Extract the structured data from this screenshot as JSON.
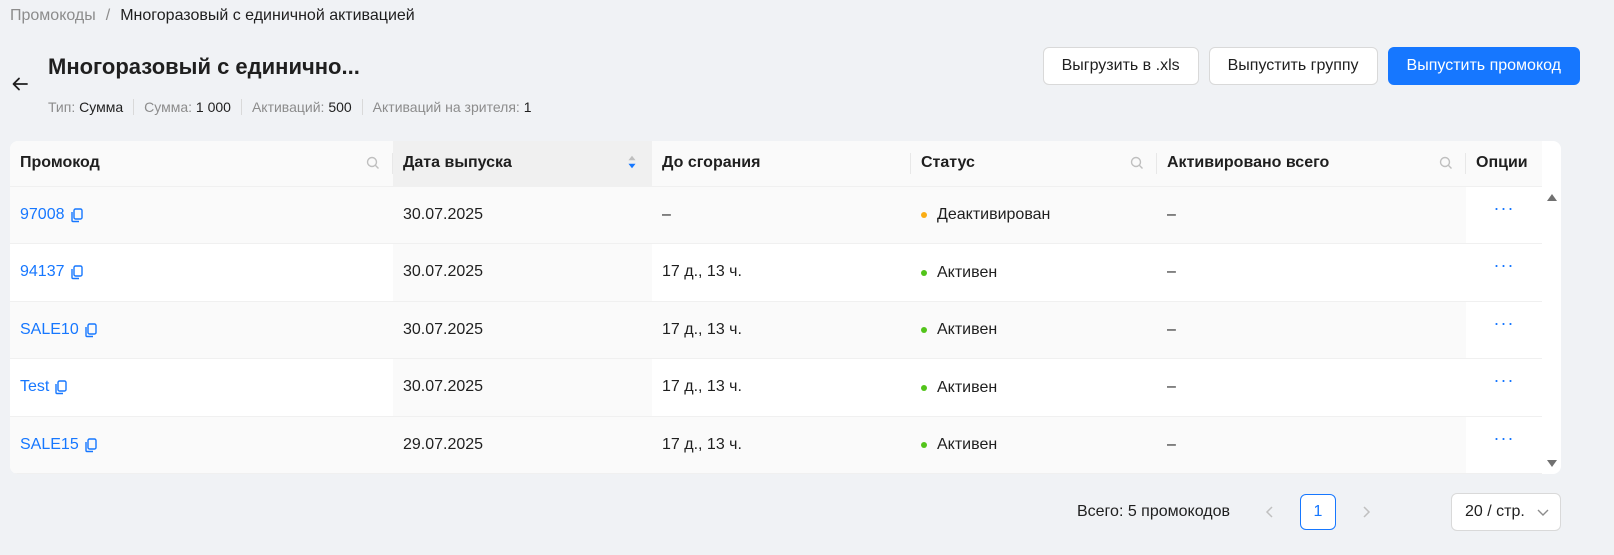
{
  "breadcrumb": {
    "parent": "Промокоды",
    "separator": "/",
    "current": "Многоразовый с единичной активацией"
  },
  "header": {
    "title": "Многоразовый с единично...",
    "meta": [
      {
        "label": "Тип:",
        "value": "Сумма"
      },
      {
        "label": "Сумма:",
        "value": "1 000"
      },
      {
        "label": "Активаций:",
        "value": "500"
      },
      {
        "label": "Активаций на зрителя:",
        "value": "1"
      }
    ]
  },
  "actions": {
    "export": "Выгрузить в .xls",
    "issue_group": "Выпустить группу",
    "issue_promo": "Выпустить промокод"
  },
  "table": {
    "columns": [
      "Промокод",
      "Дата выпуска",
      "До сгорания",
      "Статус",
      "Активировано всего",
      "Опции"
    ],
    "rows": [
      {
        "code": "97008",
        "date": "30.07.2025",
        "expires": "–",
        "status": "Деактивирован",
        "status_color": "#faad14",
        "activated": "–"
      },
      {
        "code": "94137",
        "date": "30.07.2025",
        "expires": "17 д., 13 ч.",
        "status": "Активен",
        "status_color": "#52c41a",
        "activated": "–"
      },
      {
        "code": "SALE10",
        "date": "30.07.2025",
        "expires": "17 д., 13 ч.",
        "status": "Активен",
        "status_color": "#52c41a",
        "activated": "–"
      },
      {
        "code": "Test",
        "date": "30.07.2025",
        "expires": "17 д., 13 ч.",
        "status": "Активен",
        "status_color": "#52c41a",
        "activated": "–"
      },
      {
        "code": "SALE15",
        "date": "29.07.2025",
        "expires": "17 д., 13 ч.",
        "status": "Активен",
        "status_color": "#52c41a",
        "activated": "–"
      }
    ],
    "options_glyph": "···"
  },
  "pagination": {
    "total": "Всего: 5 промокодов",
    "current_page": "1",
    "page_size": "20 / стр."
  },
  "colors": {
    "accent": "#1677ff",
    "active": "#52c41a",
    "inactive": "#faad14"
  },
  "icons": [
    "back-arrow-icon",
    "search-icon",
    "sort-icon",
    "copy-icon",
    "more-icon",
    "chevron-left-icon",
    "chevron-right-icon",
    "chevron-down-icon"
  ]
}
